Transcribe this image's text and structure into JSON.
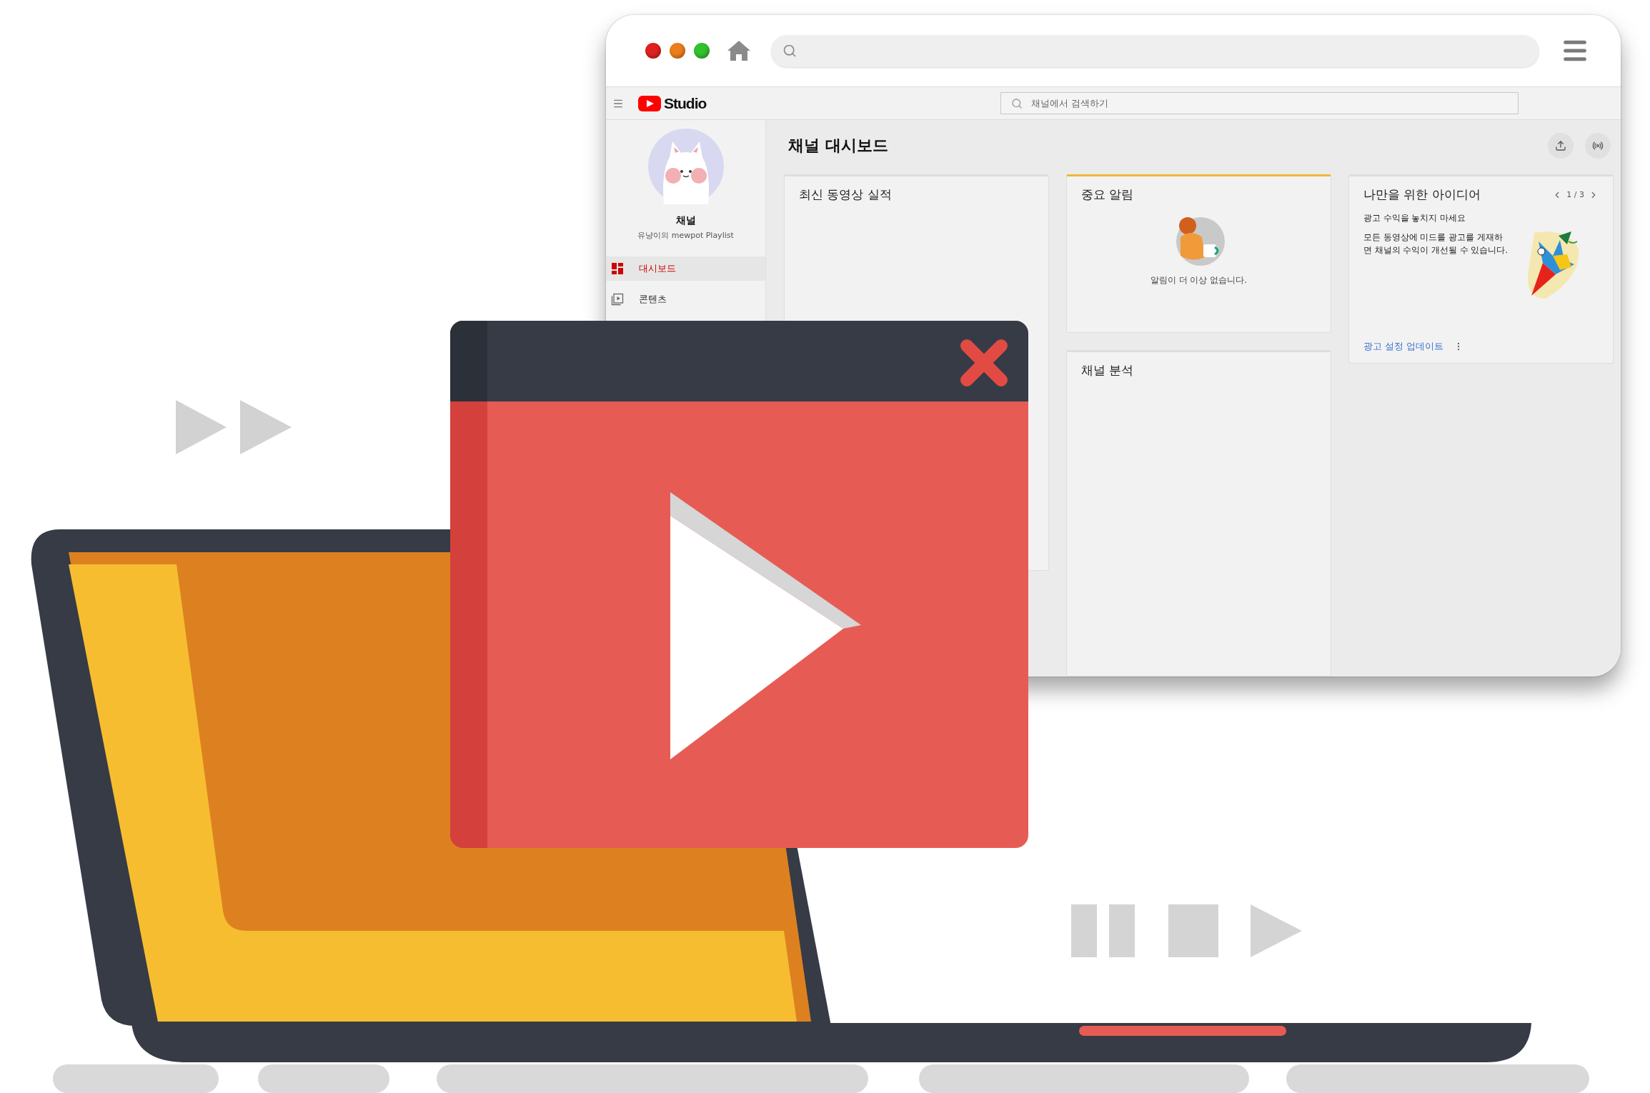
{
  "studio_header": {
    "logo_text": "Studio",
    "search": {
      "placeholder": "채널에서 검색하기"
    }
  },
  "sidebar": {
    "channel_name": "채널",
    "channel_subtitle": "유냥이의 mewpot Playlist",
    "items": [
      {
        "label": "대시보드",
        "kind": "dashboard",
        "selected": true
      },
      {
        "label": "콘텐츠",
        "kind": "content",
        "selected": false
      }
    ]
  },
  "page_title": "채널 대시보드",
  "columns": [
    [
      {
        "kind": "empty",
        "title": "최신 동영상 실적",
        "highlighted": false
      }
    ],
    [
      {
        "kind": "notifications",
        "title": "중요 알림",
        "highlighted": true,
        "message": "알림이 더 이상 없습니다."
      },
      {
        "kind": "empty",
        "title": "채널 분석",
        "highlighted": false
      }
    ],
    [
      {
        "kind": "ideas",
        "title": "나만을 위한 아이디어",
        "highlighted": false,
        "pager": "1 / 3",
        "headline": "광고 수익을 놓치지 마세요",
        "body": "모든 동영상에 미드롤 광고를 게재하면 채널의 수익이 개선될 수 있습니다.",
        "link": "광고 설정 업데이트"
      }
    ]
  ]
}
